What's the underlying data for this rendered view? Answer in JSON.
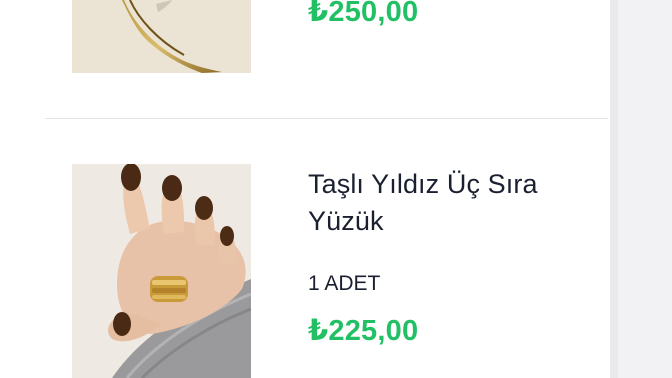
{
  "cart": {
    "items": [
      {
        "price": "₺250,00",
        "image_icon": "gold-ring-product-image"
      },
      {
        "name": "Taşlı Yıldız Üç Sıra Yüzük",
        "quantity": "1 ADET",
        "price": "₺225,00",
        "image_icon": "hand-with-ring-product-image"
      }
    ]
  },
  "colors": {
    "price": "#22c065",
    "text": "#1b2030",
    "divider": "#e3e3e6"
  }
}
